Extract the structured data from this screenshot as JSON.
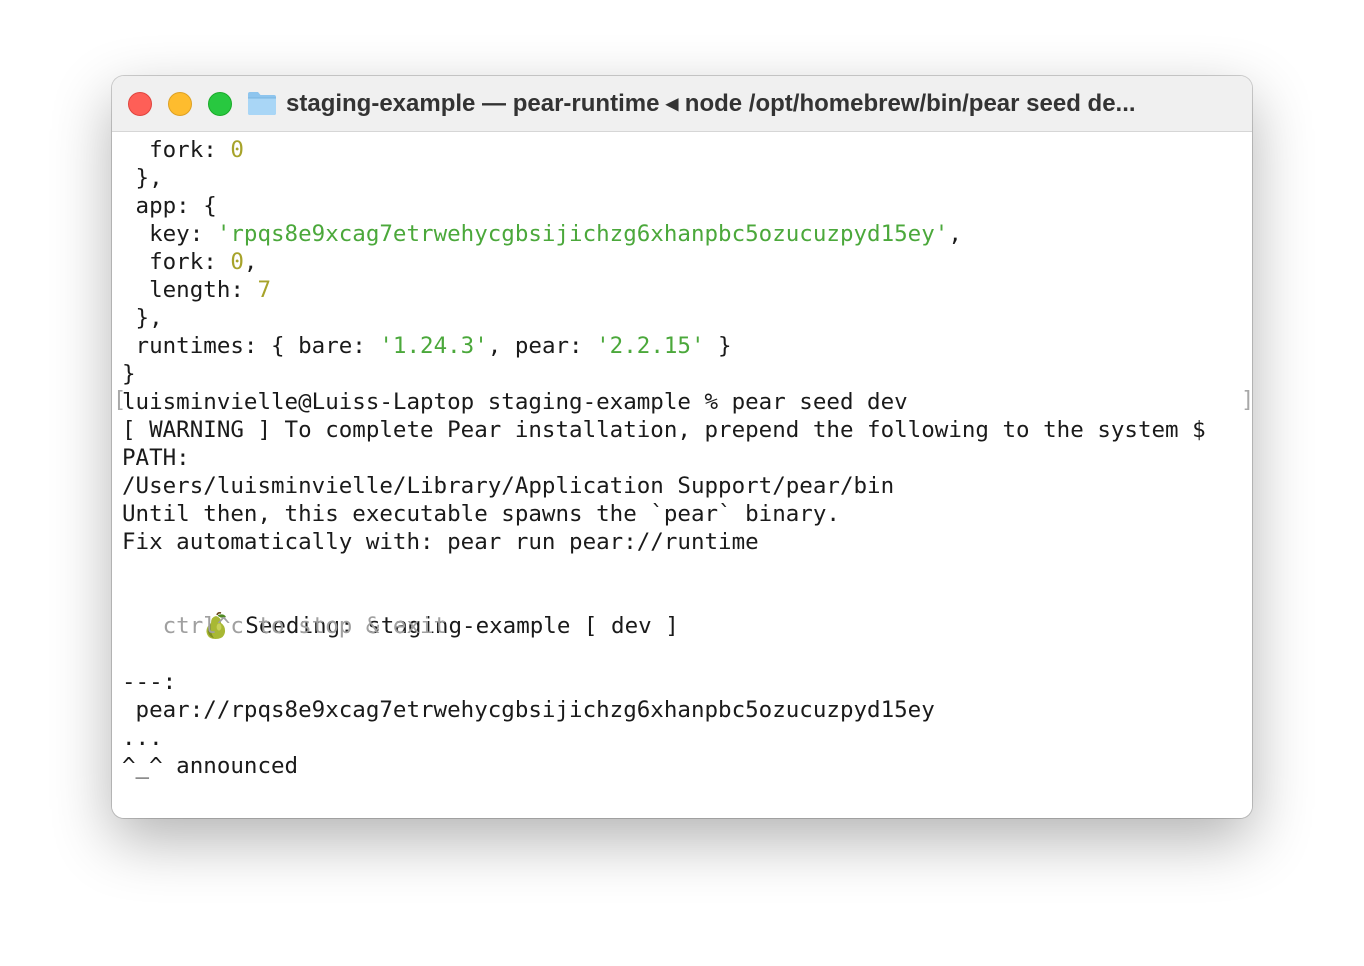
{
  "window": {
    "title": "staging-example — pear-runtime ◂ node /opt/homebrew/bin/pear seed de..."
  },
  "terminal": {
    "lines": {
      "l1": {
        "a": "  fork: ",
        "b": "0"
      },
      "l2": {
        "a": " },"
      },
      "l3": {
        "a": " app: {"
      },
      "l4": {
        "a": "  key: ",
        "b": "'rpqs8e9xcag7etrwehycgbsijichzg6xhanpbc5ozucuzpyd15ey'",
        "c": ","
      },
      "l5": {
        "a": "  fork: ",
        "b": "0",
        "c": ","
      },
      "l6": {
        "a": "  length: ",
        "b": "7"
      },
      "l7": {
        "a": " },"
      },
      "l8": {
        "a": " runtimes: { bare: ",
        "b": "'1.24.3'",
        "c": ", pear: ",
        "d": "'2.2.15'",
        "e": " }"
      },
      "l9": {
        "a": "}"
      },
      "l10": {
        "a": "luisminvielle@Luiss-Laptop staging-example % pear seed dev"
      },
      "l11": {
        "a": "[ WARNING ] To complete Pear installation, prepend the following to the system $"
      },
      "l12": {
        "a": "PATH:"
      },
      "l13": {
        "a": "/Users/luisminvielle/Library/Application Support/pear/bin"
      },
      "l14": {
        "a": "Until then, this executable spawns the `pear` binary."
      },
      "l15": {
        "a": "Fix automatically with: pear run pear://runtime"
      },
      "l17": {
        "a": "Seeding: staging-example [ dev ]"
      },
      "l18": {
        "a": "   ctrl^c to stop & exit"
      },
      "l20": {
        "a": "---:"
      },
      "l21": {
        "a": " pear://rpqs8e9xcag7etrwehycgbsijichzg6xhanpbc5ozucuzpyd15ey"
      },
      "l22": {
        "a": "..."
      },
      "l23": {
        "a": "^_^ announced"
      }
    },
    "mark_left": "[",
    "mark_right": "]"
  },
  "colors": {
    "number": "#a7a32a",
    "string": "#4ba83b",
    "dim": "#a0a0a0",
    "close": "#fe5f57",
    "minimize": "#febc2e",
    "maximize": "#28c840"
  },
  "icons": {
    "close": "close-icon",
    "minimize": "minimize-icon",
    "maximize": "maximize-icon",
    "folder": "folder-icon",
    "pear": "pear-emoji-icon"
  }
}
